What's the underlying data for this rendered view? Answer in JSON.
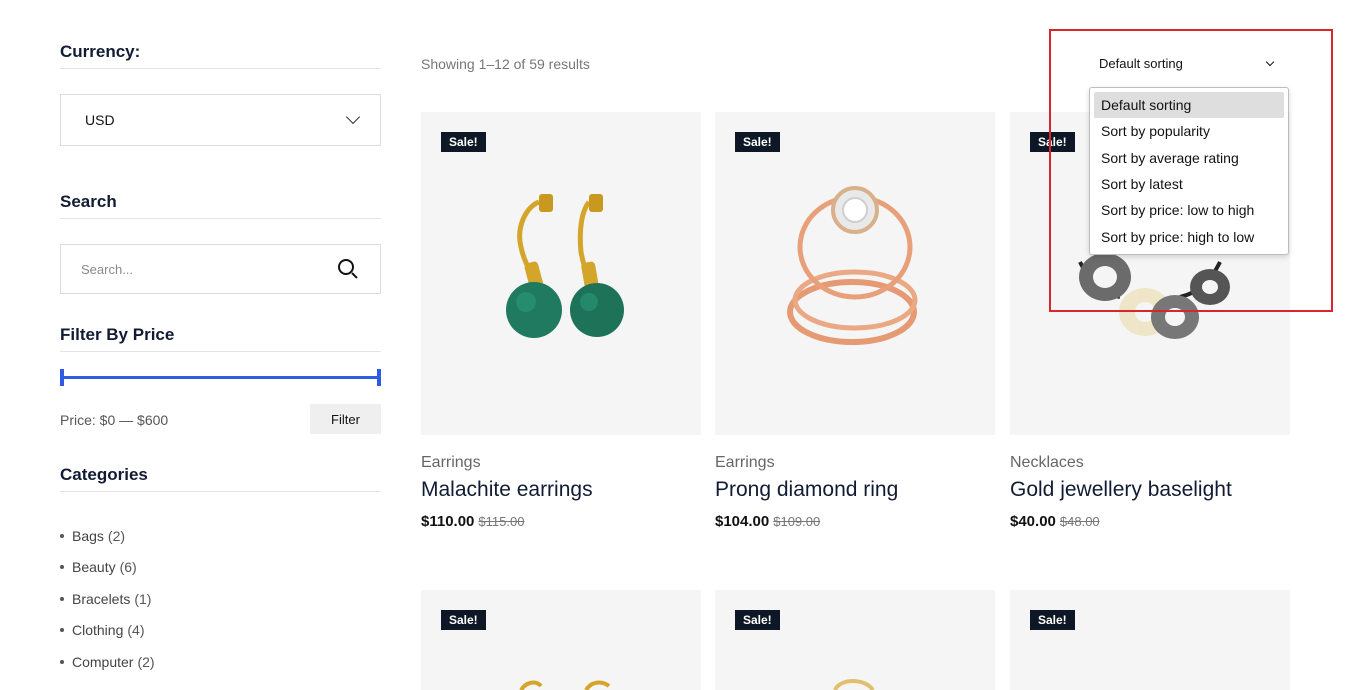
{
  "sidebar": {
    "currency_title": "Currency:",
    "currency_value": "USD",
    "search_title": "Search",
    "search_placeholder": "Search...",
    "price_title": "Filter By Price",
    "price_range_min_pct": 0,
    "price_range_max_pct": 100,
    "price_label": "Price: $0 — $600",
    "filter_label": "Filter",
    "categories_title": "Categories",
    "categories": [
      {
        "name": "Bags",
        "count": "(2)"
      },
      {
        "name": "Beauty",
        "count": "(6)"
      },
      {
        "name": "Bracelets",
        "count": "(1)"
      },
      {
        "name": "Clothing",
        "count": "(4)"
      },
      {
        "name": "Computer",
        "count": "(2)"
      }
    ]
  },
  "toolbar": {
    "result_count": "Showing 1–12 of 59 results",
    "sort_selected": "Default sorting",
    "sort_options": [
      "Default sorting",
      "Sort by popularity",
      "Sort by average rating",
      "Sort by latest",
      "Sort by price: low to high",
      "Sort by price: high to low"
    ]
  },
  "products": [
    {
      "badge": "Sale!",
      "category": "Earrings",
      "title": "Malachite earrings",
      "price": "$110.00",
      "old_price": "$115.00"
    },
    {
      "badge": "Sale!",
      "category": "Earrings",
      "title": "Prong diamond ring",
      "price": "$104.00",
      "old_price": "$109.00"
    },
    {
      "badge": "Sale!",
      "category": "Necklaces",
      "title": "Gold jewellery baselight",
      "price": "$40.00",
      "old_price": "$48.00"
    },
    {
      "badge": "Sale!"
    },
    {
      "badge": "Sale!"
    },
    {
      "badge": "Sale!"
    }
  ],
  "colors": {
    "accent": "#2e5ce6",
    "badge_bg": "#0d1726",
    "highlight": "#d9262c"
  }
}
